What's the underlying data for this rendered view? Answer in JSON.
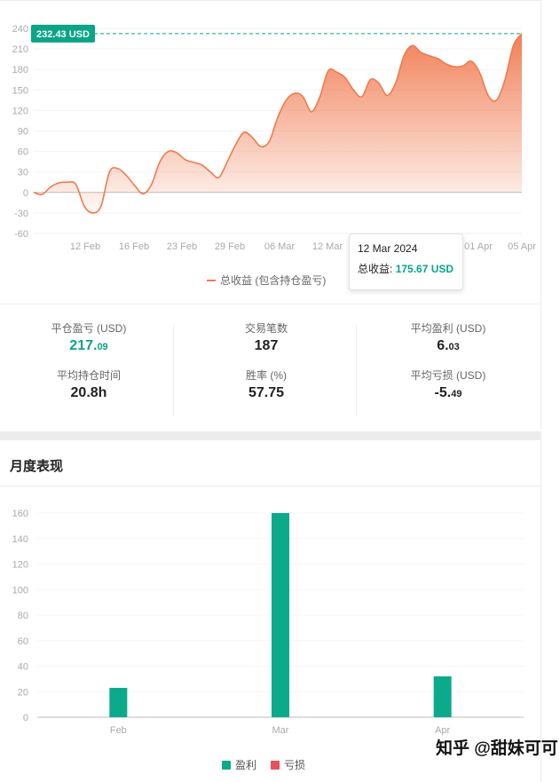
{
  "line_chart": {
    "current_label": "232.43 USD",
    "tooltip": {
      "date": "12 Mar 2024",
      "label": "总收益:",
      "value": "175.67 USD"
    },
    "legend": "总收益 (包含持仓盈亏)",
    "colors": {
      "line": "#f07a4f",
      "accent": "#0aa487"
    }
  },
  "stats": {
    "col1": {
      "label1": "平仓盈亏 (USD)",
      "value1_main": "217.",
      "value1_dec": "09",
      "label2": "平均持仓时间",
      "value2": "20.8h"
    },
    "col2": {
      "label1": "交易笔数",
      "value1": "187",
      "label2": "胜率 (%)",
      "value2": "57.75"
    },
    "col3": {
      "label1": "平均盈利 (USD)",
      "value1_main": "6.",
      "value1_dec": "03",
      "label2": "平均亏损 (USD)",
      "value2_main": "-5.",
      "value2_dec": "49"
    }
  },
  "monthly": {
    "title": "月度表现",
    "legend_profit": "盈利",
    "legend_loss": "亏损",
    "colors": {
      "profit": "#0aaa8a",
      "loss": "#e8505b"
    }
  },
  "watermark": "知乎 @甜妹可可",
  "chart_data": [
    {
      "type": "area",
      "yticks": [
        240,
        210,
        180,
        150,
        120,
        90,
        60,
        30,
        0,
        -30,
        -60
      ],
      "ylim": [
        -60,
        240
      ],
      "xticks": [
        "12 Feb",
        "16 Feb",
        "23 Feb",
        "29 Feb",
        "06 Mar",
        "12 Mar",
        "01 Apr",
        "05 Apr"
      ],
      "series": [
        {
          "name": "总收益 (包含持仓盈亏)",
          "values": [
            0,
            -3,
            8,
            14,
            15,
            12,
            -20,
            -30,
            -20,
            30,
            35,
            25,
            10,
            -2,
            12,
            45,
            60,
            58,
            48,
            44,
            40,
            30,
            22,
            45,
            70,
            88,
            80,
            67,
            75,
            110,
            135,
            145,
            140,
            118,
            140,
            178,
            176,
            168,
            150,
            140,
            165,
            160,
            142,
            160,
            200,
            215,
            205,
            200,
            196,
            188,
            184,
            185,
            192,
            175,
            142,
            135,
            165,
            215,
            232.43
          ]
        }
      ],
      "current_value": 232.43
    },
    {
      "type": "bar",
      "categories": [
        "Feb",
        "Mar",
        "Apr"
      ],
      "yticks": [
        0,
        20,
        40,
        60,
        80,
        100,
        120,
        140,
        160
      ],
      "ylim": [
        0,
        160
      ],
      "series": [
        {
          "name": "盈利",
          "values": [
            23,
            160,
            32
          ]
        },
        {
          "name": "亏损",
          "values": [
            0,
            0,
            0
          ]
        }
      ]
    }
  ]
}
